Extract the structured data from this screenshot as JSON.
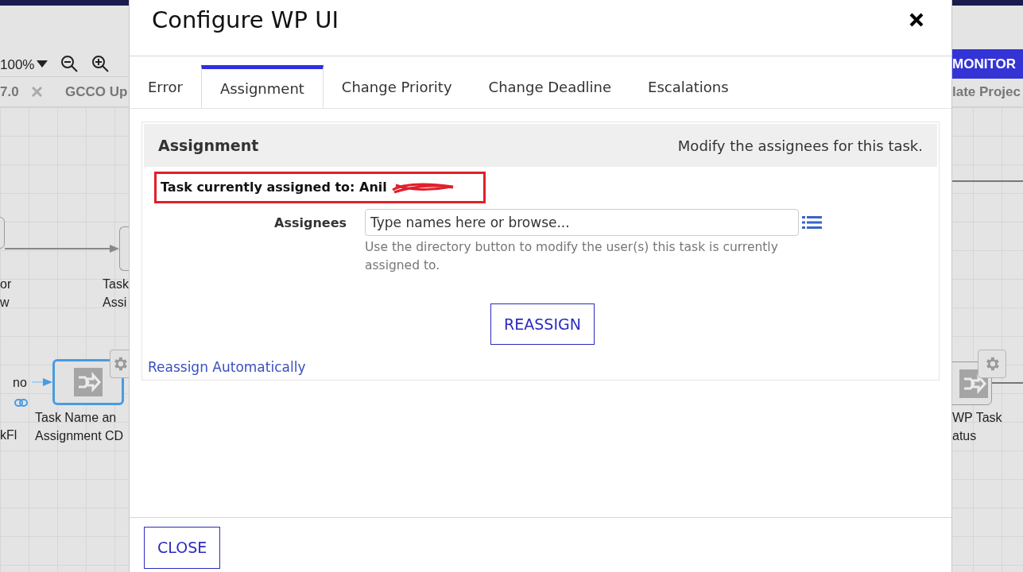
{
  "background": {
    "zoom": "100%",
    "open_tabs": [
      {
        "label": "7.0",
        "closable": true
      },
      {
        "label": "GCCO Up",
        "closable": false
      }
    ],
    "right_tab": "late Projec",
    "monitor_button": "MONITOR",
    "nodes": [
      {
        "label": [
          "or",
          "w"
        ],
        "selected": false
      },
      {
        "label": [
          "Task",
          "Assi"
        ],
        "selected": false
      },
      {
        "label": [
          "Task Name an",
          "Assignment CD"
        ],
        "selected": true
      },
      {
        "label": [
          "WP Task",
          "atus"
        ],
        "selected": false
      }
    ],
    "edge_label": "no",
    "stray_text": "kFl"
  },
  "dialog": {
    "title": "Configure WP UI",
    "tabs": [
      {
        "label": "Error",
        "selected": false
      },
      {
        "label": "Assignment",
        "selected": true
      },
      {
        "label": "Change Priority",
        "selected": false
      },
      {
        "label": "Change Deadline",
        "selected": false
      },
      {
        "label": "Escalations",
        "selected": false
      }
    ],
    "panel": {
      "title": "Assignment",
      "description": "Modify the assignees for this task.",
      "current_assignee": "Task currently assigned to: Anil",
      "assignees_label": "Assignees",
      "assignees_placeholder": "Type names here or browse...",
      "help": "Use the directory button to modify the user(s) this task is currently assigned to.",
      "reassign_button": "REASSIGN",
      "auto_link": "Reassign Automatically"
    },
    "close_button": "CLOSE"
  }
}
